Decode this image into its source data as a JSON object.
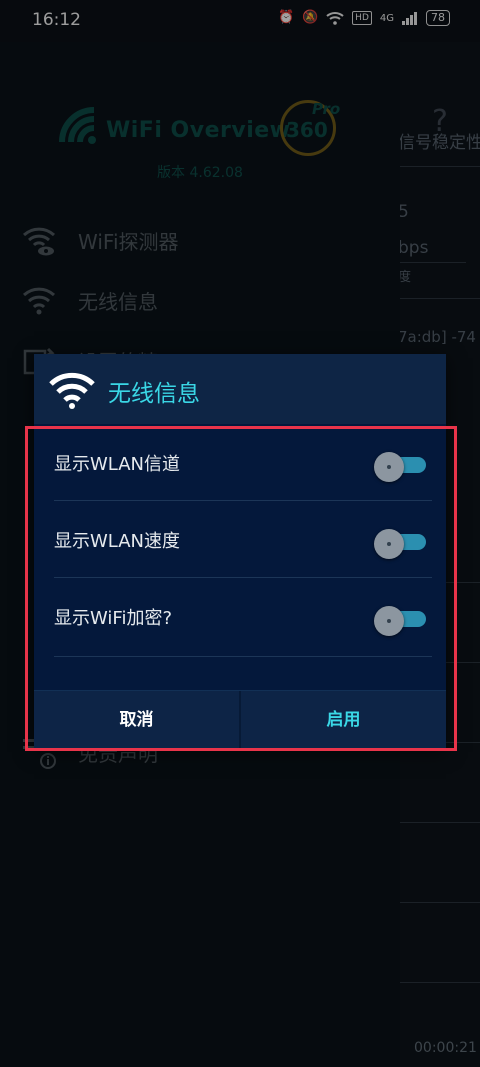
{
  "status_bar": {
    "time": "16:12",
    "network": "4G",
    "hd": "HD",
    "battery": "78"
  },
  "background_app": {
    "help_symbol": "?",
    "fragments": [
      "信号稳定性",
      "5",
      "bps",
      "度",
      "7a:db] -74"
    ],
    "timer": "00:00:21"
  },
  "drawer": {
    "logo_text": "WiFi Overview",
    "logo_number": "360",
    "logo_badge": "Pro",
    "version": "版本 4.62.08",
    "items": [
      {
        "label": "WiFi探测器",
        "icon": "wifi-eye-icon"
      },
      {
        "label": "无线信息",
        "icon": "wifi-icon"
      },
      {
        "label": "设置的精",
        "icon": "share-icon"
      },
      {
        "label": "免责声明",
        "icon": "info-icon"
      }
    ]
  },
  "dialog": {
    "icon": "wifi-icon",
    "title": "无线信息",
    "options": [
      {
        "label": "显示WLAN信道",
        "enabled": false
      },
      {
        "label": "显示WLAN速度",
        "enabled": false
      },
      {
        "label": "显示WiFi加密?",
        "enabled": false
      }
    ],
    "cancel_label": "取消",
    "enable_label": "启用"
  },
  "colors": {
    "accent": "#3ad7e6",
    "dialog_body": "#04183b",
    "dialog_header": "#0e2545",
    "highlight": "#e8344a",
    "toggle_track": "#2b8fb0"
  }
}
